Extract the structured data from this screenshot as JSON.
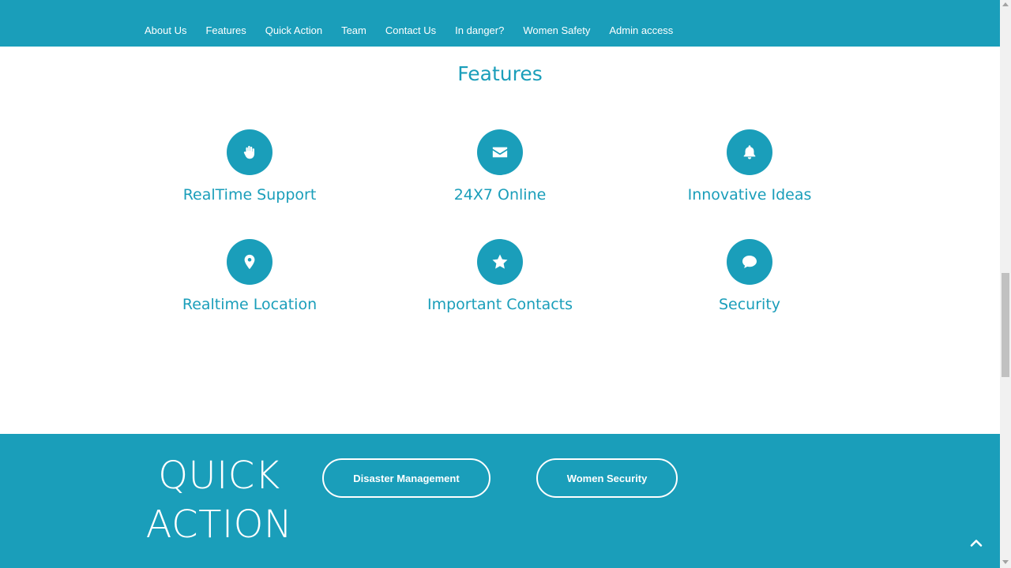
{
  "nav": {
    "items": [
      {
        "label": "About Us"
      },
      {
        "label": "Features"
      },
      {
        "label": "Quick Action"
      },
      {
        "label": "Team"
      },
      {
        "label": "Contact Us"
      },
      {
        "label": "In danger?"
      },
      {
        "label": "Women Safety"
      },
      {
        "label": "Admin access"
      }
    ]
  },
  "features": {
    "title": "Features",
    "items": [
      {
        "label": "RealTime Support",
        "icon": "hand-icon"
      },
      {
        "label": "24X7 Online",
        "icon": "envelope-icon"
      },
      {
        "label": "Innovative Ideas",
        "icon": "bell-icon"
      },
      {
        "label": "Realtime Location",
        "icon": "map-marker-icon"
      },
      {
        "label": "Important Contacts",
        "icon": "star-icon"
      },
      {
        "label": "Security",
        "icon": "comment-icon"
      }
    ]
  },
  "quick_action": {
    "title_line1": "QUICK",
    "title_line2": "ACTION",
    "buttons": [
      {
        "label": "Disaster Management"
      },
      {
        "label": "Women Security"
      }
    ]
  },
  "colors": {
    "brand": "#1a9eba",
    "text_on_brand": "#ffffff"
  }
}
